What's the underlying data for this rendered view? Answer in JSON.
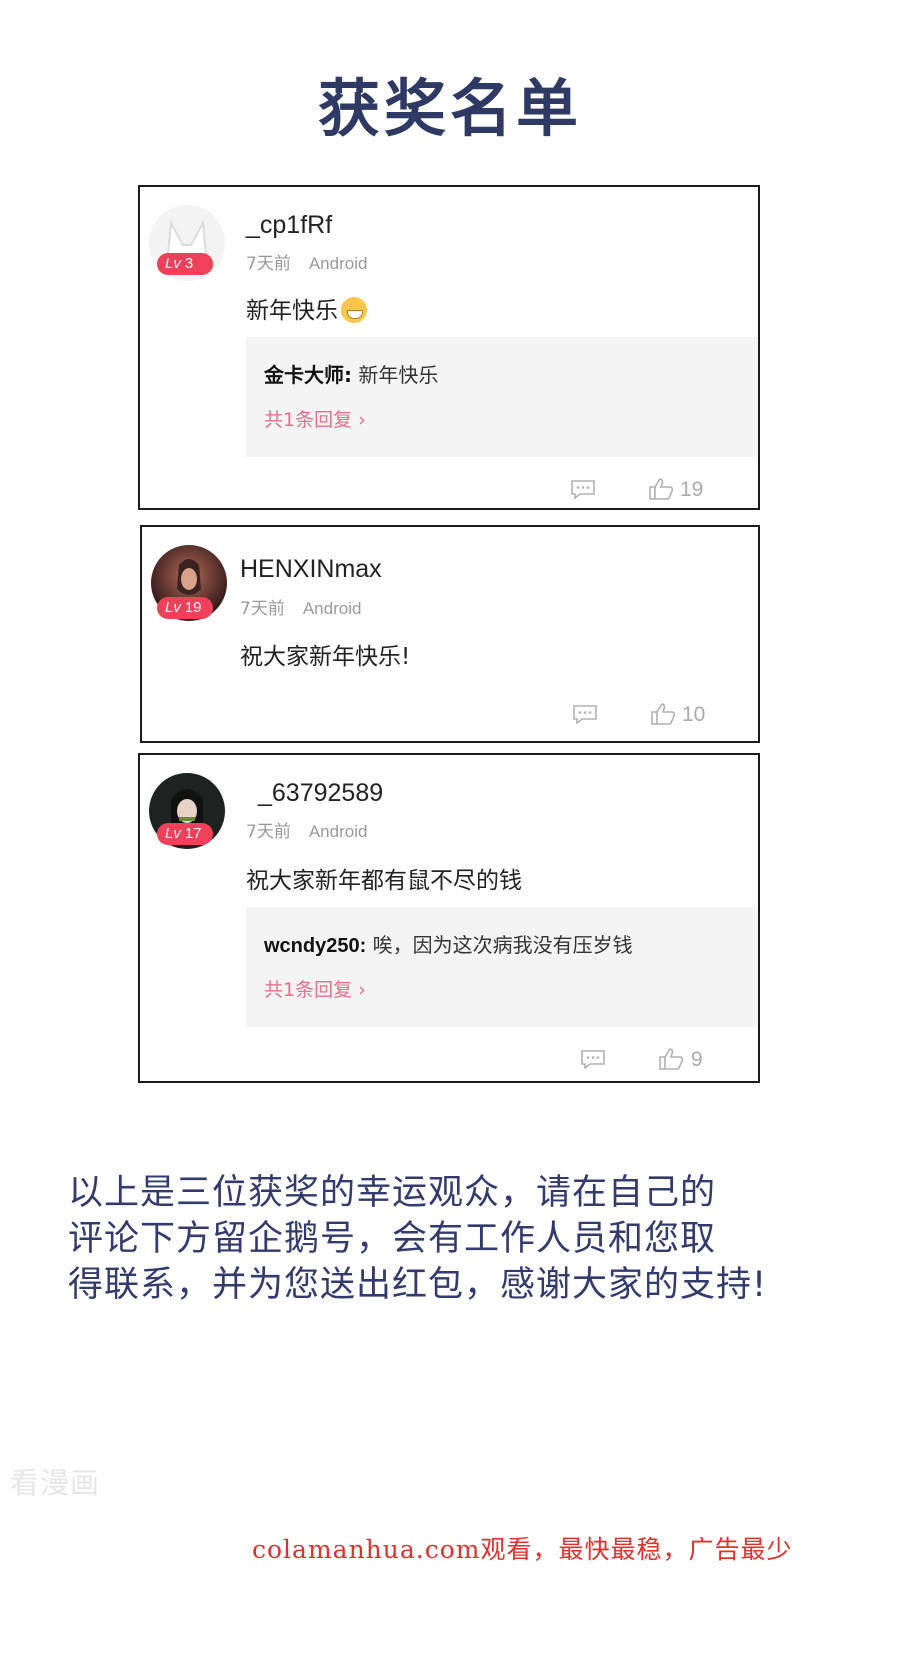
{
  "title": "获奖名单",
  "comments": [
    {
      "username": "_cp1fRf",
      "level_prefix": "Lv",
      "level": "3",
      "time": "7天前",
      "platform": "Android",
      "text": "新年快乐",
      "has_emoji": true,
      "reply": {
        "user": "金卡大师:",
        "text": "新年快乐",
        "link": "共1条回复 ›"
      },
      "likes": "19"
    },
    {
      "username": "HENXINmax",
      "level_prefix": "Lv",
      "level": "19",
      "time": "7天前",
      "platform": "Android",
      "text": "祝大家新年快乐!",
      "likes": "10"
    },
    {
      "username": "_63792589",
      "level_prefix": "Lv",
      "level": "17",
      "time": "7天前",
      "platform": "Android",
      "text": "祝大家新年都有鼠不尽的钱",
      "reply": {
        "user": "wcndy250:",
        "text": "唉，因为这次病我没有压岁钱",
        "link": "共1条回复 ›"
      },
      "likes": "9"
    }
  ],
  "announcement": {
    "line1": "以上是三位获奖的幸运观众，请在自己的",
    "line2": "评论下方留企鹅号，会有工作人员和您取",
    "line3": "得联系，并为您送出红包，感谢大家的支持!"
  },
  "watermark": "看漫画",
  "source_note": "colamanhua.com观看，最快最稳，广告最少",
  "colors": {
    "title": "#2e3a63",
    "level_badge": "#f0405a",
    "reply_link": "#e4718a",
    "source_note": "#e0312c"
  },
  "icons": {
    "comment": "comment-bubble-icon",
    "like": "thumbs-up-icon"
  }
}
